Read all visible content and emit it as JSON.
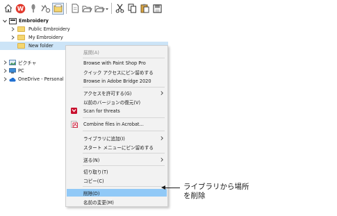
{
  "toolbar": {
    "icons": [
      "home-icon",
      "wilcom-logo-icon",
      "pin-icon",
      "stitch-tool-icon",
      "folder-view-icon",
      "new-file-icon",
      "open-folder-icon",
      "folder-dropdown-icon",
      "cut-icon",
      "copy-icon",
      "paste-icon",
      "save-icon"
    ]
  },
  "tree": {
    "root": "Embroidery",
    "children": [
      "Public Embroidery",
      "My Embroidery",
      "New folder"
    ],
    "other_items": [
      "ピクチャ",
      "PC",
      "OneDrive - Personal"
    ]
  },
  "context_menu": {
    "items": [
      {
        "label": "展開(A)",
        "disabled": true
      },
      {
        "label": "Browse with Paint Shop Pro"
      },
      {
        "label": "クイック アクセスにピン留めする"
      },
      {
        "label": "Browse in Adobe Bridge 2020"
      },
      {
        "label": "アクセスを許可する(G)",
        "submenu": true
      },
      {
        "label": "以前のバージョンの復元(V)"
      },
      {
        "label": "Scan for threats",
        "icon": "shield-icon"
      },
      {
        "label": "Combine files in Acrobat...",
        "icon": "acrobat-icon"
      },
      {
        "label": "ライブラリに追加(I)",
        "submenu": true
      },
      {
        "label": "スタート メニューにピン留めする"
      },
      {
        "label": "送る(N)",
        "submenu": true
      },
      {
        "label": "切り取り(T)"
      },
      {
        "label": "コピー(C)"
      },
      {
        "label": "削除(D)",
        "highlighted": true
      },
      {
        "label": "名前の変更(M)"
      }
    ]
  },
  "callout": {
    "line1": "ライブラリから場所",
    "line2": "を削除"
  },
  "colors": {
    "selection": "#cce4f7",
    "menu_highlight": "#91c9f7",
    "menu_background": "#f2f2f2",
    "folder": "#f5d66f"
  }
}
